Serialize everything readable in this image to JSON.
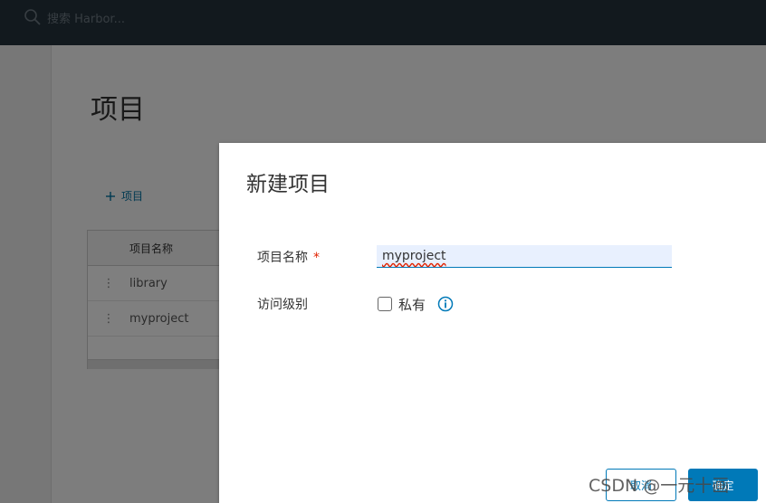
{
  "topbar": {
    "search_placeholder": "搜索 Harbor..."
  },
  "page": {
    "title": "项目",
    "new_project_label": "项目"
  },
  "table": {
    "column_header": "项目名称",
    "rows": [
      {
        "name": "library"
      },
      {
        "name": "myproject"
      }
    ]
  },
  "modal": {
    "title": "新建项目",
    "name_label": "项目名称",
    "required_marker": "*",
    "name_value": "myproject",
    "access_label": "访问级别",
    "private_label": "私有",
    "private_checked": false,
    "cancel_label": "取消",
    "ok_label": "确定"
  },
  "watermark": "CSDN @一元十画",
  "icons": [
    "search-icon",
    "plus-icon",
    "row-menu-icon",
    "info-icon"
  ],
  "colors": {
    "topbar": "#25333d",
    "accent": "#0079b8",
    "required": "#e12200"
  }
}
